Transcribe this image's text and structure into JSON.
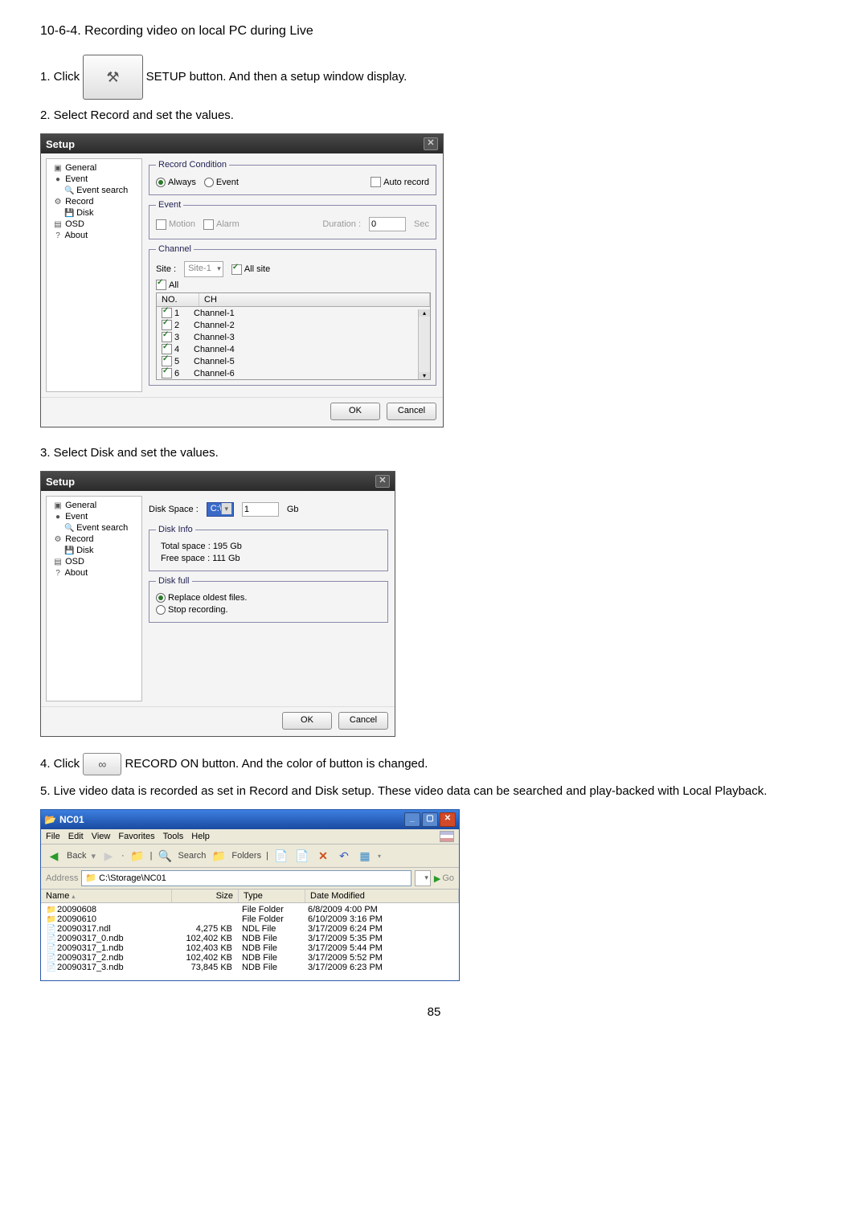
{
  "heading": "10-6-4. Recording video on local PC during Live",
  "step1_pre": "1. Click",
  "step1_post": "SETUP button. And then a setup window display.",
  "step2": "2. Select Record and set the values.",
  "step3": "3. Select Disk and set the values.",
  "step4_pre": "4. Click",
  "step4_post": "RECORD ON button. And the color of button is changed.",
  "step5": "5. Live video data is recorded as set in Record and Disk setup. These video data can be searched and play-backed with Local Playback.",
  "page_number": "85",
  "setup": {
    "title": "Setup",
    "nav": [
      "General",
      "Event",
      "Event search",
      "Record",
      "Disk",
      "OSD",
      "About"
    ],
    "record_cond_legend": "Record Condition",
    "always": "Always",
    "event_radio": "Event",
    "auto_record": "Auto record",
    "event_legend": "Event",
    "motion": "Motion",
    "alarm": "Alarm",
    "duration": "Duration :",
    "duration_val": "0",
    "sec": "Sec",
    "channel_legend": "Channel",
    "site_label": "Site :",
    "site_val": "Site-1",
    "all_site": "All site",
    "all": "All",
    "no_hdr": "NO.",
    "ch_hdr": "CH",
    "channels": [
      {
        "no": "1",
        "ch": "Channel-1"
      },
      {
        "no": "2",
        "ch": "Channel-2"
      },
      {
        "no": "3",
        "ch": "Channel-3"
      },
      {
        "no": "4",
        "ch": "Channel-4"
      },
      {
        "no": "5",
        "ch": "Channel-5"
      },
      {
        "no": "6",
        "ch": "Channel-6"
      }
    ],
    "ok": "OK",
    "cancel": "Cancel"
  },
  "disk": {
    "title": "Setup",
    "disk_space_label": "Disk Space :",
    "disk_drive": "C:\\",
    "disk_val": "1",
    "gb": "Gb",
    "disk_info_legend": "Disk Info",
    "total": "Total space : 195 Gb",
    "free": "Free space : 111 Gb",
    "disk_full_legend": "Disk full",
    "replace": "Replace oldest files.",
    "stop": "Stop recording.",
    "ok": "OK",
    "cancel": "Cancel"
  },
  "explorer": {
    "title": "NC01",
    "menu": [
      "File",
      "Edit",
      "View",
      "Favorites",
      "Tools",
      "Help"
    ],
    "back": "Back",
    "search": "Search",
    "folders": "Folders",
    "address_label": "Address",
    "address": "C:\\Storage\\NC01",
    "go": "Go",
    "cols": {
      "name": "Name",
      "size": "Size",
      "type": "Type",
      "date": "Date Modified"
    },
    "rows": [
      {
        "icon": "📁",
        "name": "20090608",
        "size": "",
        "type": "File Folder",
        "date": "6/8/2009 4:00 PM"
      },
      {
        "icon": "📁",
        "name": "20090610",
        "size": "",
        "type": "File Folder",
        "date": "6/10/2009 3:16 PM"
      },
      {
        "icon": "📄",
        "name": "20090317.ndl",
        "size": "4,275 KB",
        "type": "NDL File",
        "date": "3/17/2009 6:24 PM"
      },
      {
        "icon": "📄",
        "name": "20090317_0.ndb",
        "size": "102,402 KB",
        "type": "NDB File",
        "date": "3/17/2009 5:35 PM"
      },
      {
        "icon": "📄",
        "name": "20090317_1.ndb",
        "size": "102,403 KB",
        "type": "NDB File",
        "date": "3/17/2009 5:44 PM"
      },
      {
        "icon": "📄",
        "name": "20090317_2.ndb",
        "size": "102,402 KB",
        "type": "NDB File",
        "date": "3/17/2009 5:52 PM"
      },
      {
        "icon": "📄",
        "name": "20090317_3.ndb",
        "size": "73,845 KB",
        "type": "NDB File",
        "date": "3/17/2009 6:23 PM"
      }
    ]
  }
}
